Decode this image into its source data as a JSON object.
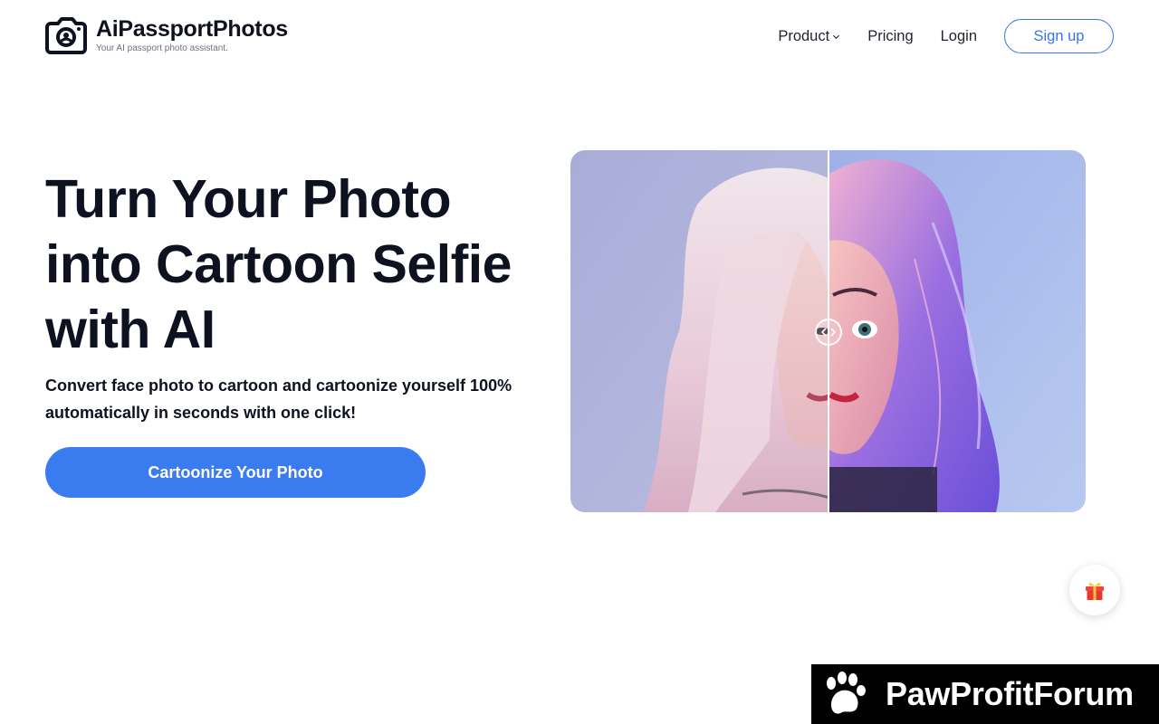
{
  "brand": {
    "name": "AiPassportPhotos",
    "tagline": "Your AI passport photo assistant.",
    "logo_icon": "camera-icon"
  },
  "nav": {
    "items": [
      {
        "label": "Product",
        "has_dropdown": true
      },
      {
        "label": "Pricing"
      },
      {
        "label": "Login"
      }
    ],
    "signup_label": "Sign up"
  },
  "hero": {
    "title_lines": [
      "Turn Your Photo",
      "into Cartoon Selfie",
      "with AI"
    ],
    "subtitle_lines": [
      "Convert face photo to cartoon and cartoonize yourself 100%",
      "automatically in seconds with one click!"
    ],
    "cta_label": "Cartoonize Your Photo"
  },
  "comparison": {
    "left_icon": "original-photo",
    "right_icon": "cartoon-photo",
    "handle_icon": "compare-slider-icon"
  },
  "floating": {
    "gift_icon": "gift-icon"
  },
  "watermark": {
    "text": "PawProfitForum",
    "icon": "paw-icon"
  },
  "colors": {
    "accent": "#3b7bf0",
    "signup_border": "#3b74e8",
    "text": "#0e1220",
    "banner_bg": "#000000"
  }
}
